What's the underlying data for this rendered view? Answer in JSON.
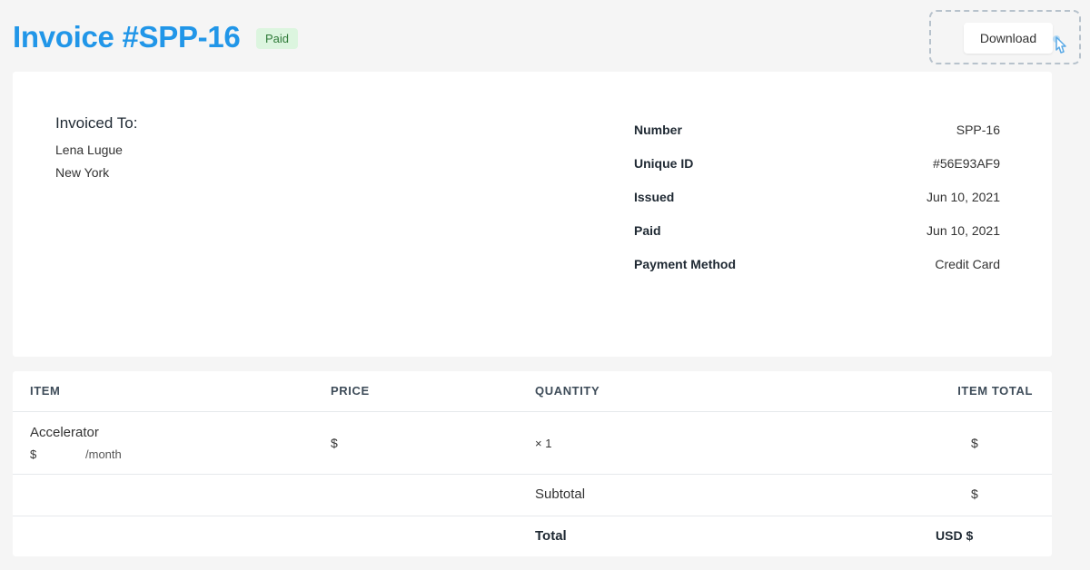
{
  "header": {
    "title": "Invoice #SPP-16",
    "status_badge": "Paid",
    "download_label": "Download"
  },
  "invoiced_to": {
    "heading": "Invoiced To:",
    "name": "Lena Lugue",
    "city": "New York"
  },
  "details": [
    {
      "label": "Number",
      "value": "SPP-16"
    },
    {
      "label": "Unique ID",
      "value": "#56E93AF9"
    },
    {
      "label": "Issued",
      "value": "Jun 10, 2021"
    },
    {
      "label": "Paid",
      "value": "Jun 10, 2021"
    },
    {
      "label": "Payment Method",
      "value": "Credit Card"
    }
  ],
  "table": {
    "columns": [
      "ITEM",
      "PRICE",
      "QUANTITY",
      "ITEM TOTAL"
    ],
    "items": [
      {
        "name": "Accelerator",
        "price_prefix": "$",
        "price_suffix": "/month",
        "price": "$",
        "quantity": "× 1",
        "total": "$"
      }
    ],
    "subtotal_label": "Subtotal",
    "subtotal_value": "$",
    "total_label": "Total",
    "total_value": "USD $"
  },
  "colors": {
    "accent": "#2196e8",
    "badge_bg": "#dcf5df",
    "badge_text": "#2f7a39",
    "page_bg": "#f5f5f5"
  },
  "icons": {
    "cursor": "pointer-hand-icon"
  }
}
